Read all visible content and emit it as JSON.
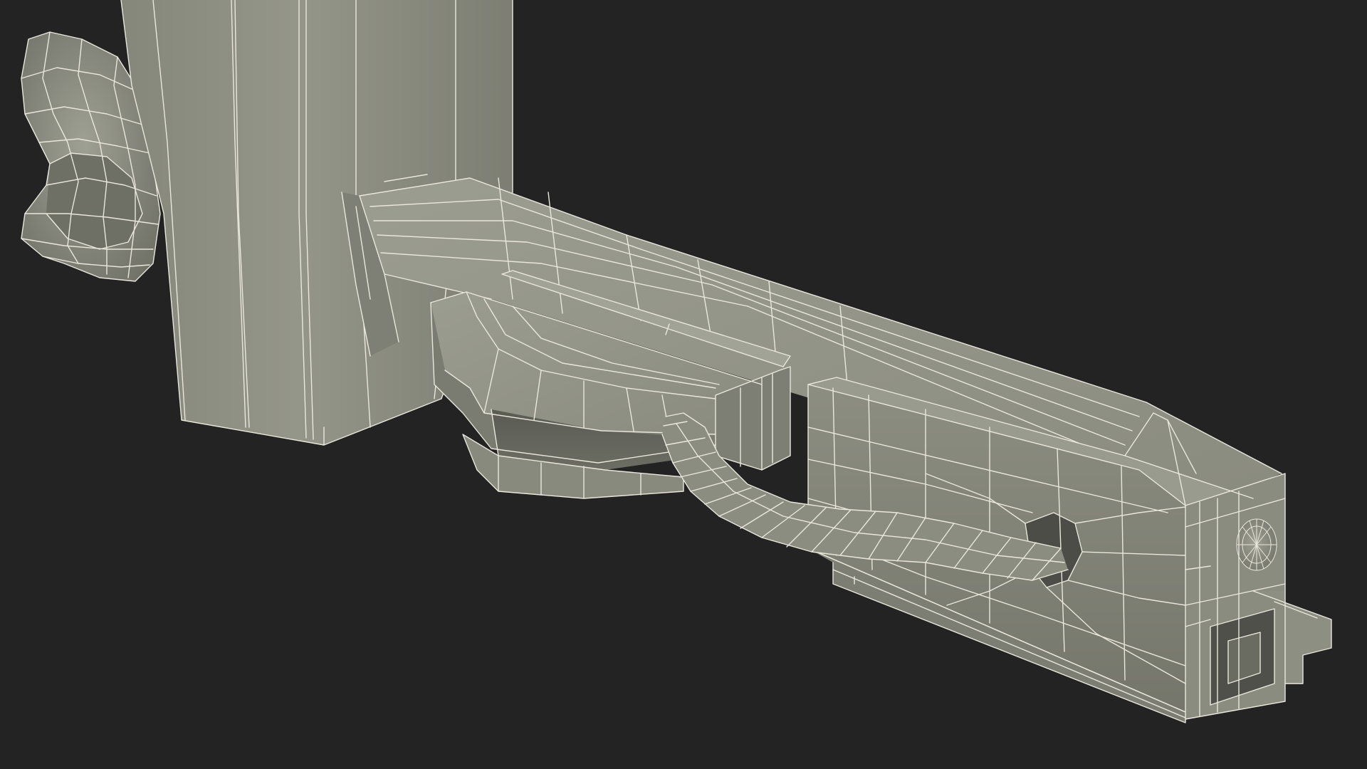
{
  "scene": {
    "background_color": "#232323",
    "mesh_color": "#8e8f83",
    "mesh_shadow_color": "#5f6058",
    "mesh_highlight_color": "#a6a79b",
    "wire_color": "#e9e7dc",
    "subject": "3d-model-wireframe-render"
  }
}
